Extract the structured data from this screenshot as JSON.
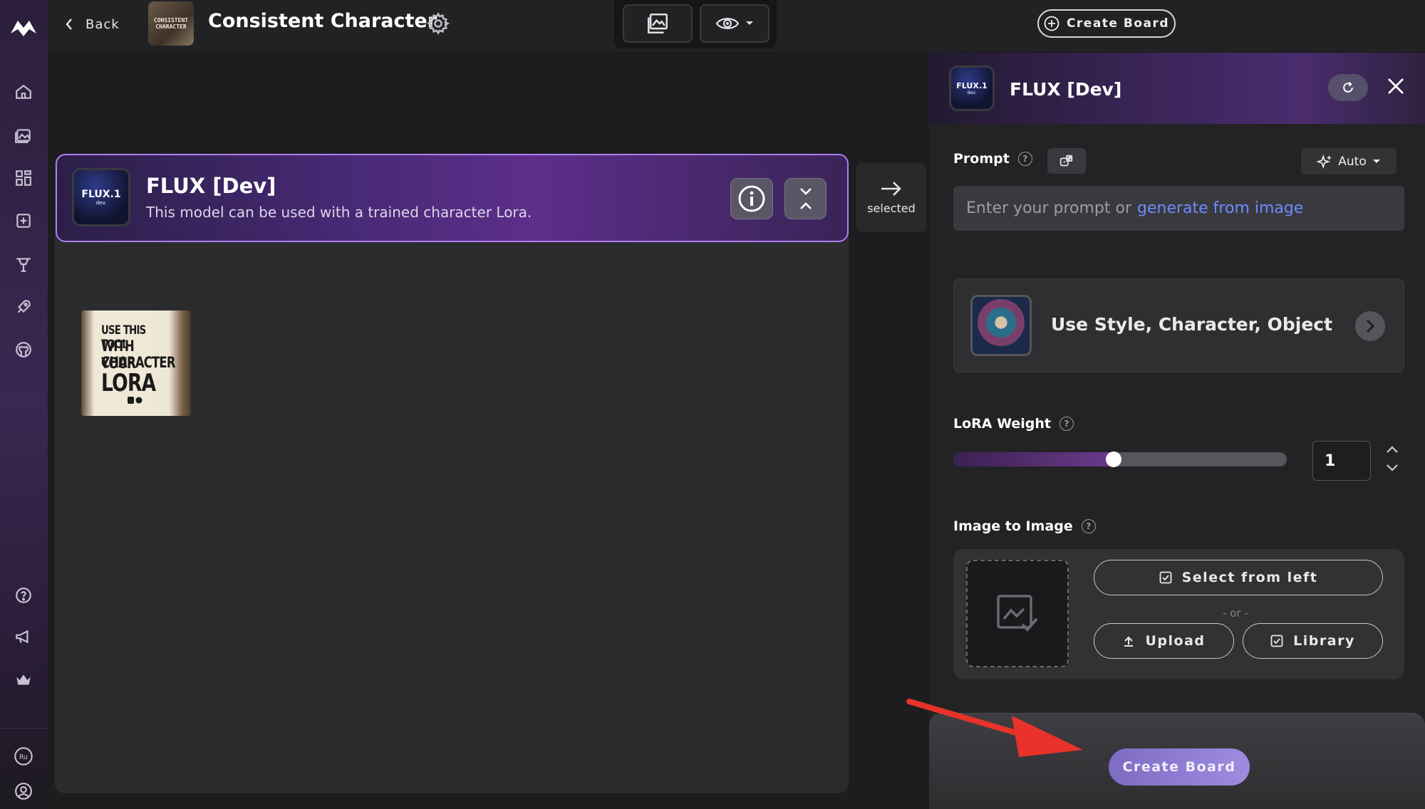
{
  "header": {
    "back_label": "Back",
    "board_thumb_text": "CONSISTENT CHARACTER",
    "board_title": "Consistent Character",
    "create_board_label": "Create Board"
  },
  "model_card": {
    "logo_text": "FLUX.1",
    "logo_sub": "dev.",
    "title": "FLUX [Dev]",
    "subtitle": "This model can be used with a trained character Lora."
  },
  "selected_button": {
    "label": "selected"
  },
  "lora_thumbnail": {
    "lines": [
      "USE THIS TOOL",
      "WITH YOUR",
      "CHARACTER",
      "LORA"
    ]
  },
  "right_panel": {
    "logo_text": "FLUX.1",
    "logo_sub": "dev.",
    "title": "FLUX [Dev]",
    "prompt": {
      "label": "Prompt",
      "auto_label": "Auto",
      "placeholder": "Enter your prompt or",
      "placeholder_link": "generate from image"
    },
    "style": {
      "label": "Use Style, Character, Object"
    },
    "lora": {
      "label": "LoRA Weight",
      "value": "1",
      "slider_fraction": 0.48
    },
    "image_to_image": {
      "label": "Image to Image",
      "select_from_left": "Select from left",
      "or_text": "- or -",
      "upload": "Upload",
      "library": "Library"
    },
    "create_board_label": "Create Board"
  },
  "colors": {
    "accent_purple": "#b07ef0",
    "link_blue": "#6e8bff",
    "arrow_red": "#e8322a",
    "create_button": "#8f7ed8"
  }
}
